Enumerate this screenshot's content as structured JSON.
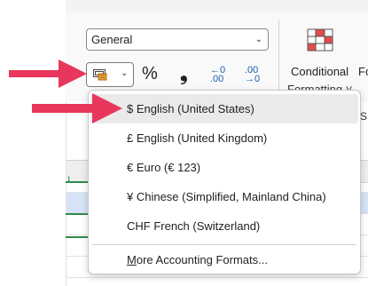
{
  "ribbon": {
    "number_format_value": "General",
    "percent_symbol": "%",
    "comma_symbol": "❟",
    "increase_decimal": {
      "top": "←0",
      "bottom": ".00"
    },
    "decrease_decimal": {
      "top": ".00",
      "bottom": "→0"
    },
    "conditional_formatting_label": "Conditional",
    "conditional_formatting_label_line2": "Formatting ˅",
    "format_label_partial": "Fo",
    "colors": {
      "accent": "#e8365d",
      "green": "#2e8b4a",
      "selection": "#d6e3f6"
    }
  },
  "accounting_menu": {
    "items": [
      {
        "label": "$ English (United States)"
      },
      {
        "label": "£ English (United Kingdom)"
      },
      {
        "label": "€ Euro (€ 123)"
      },
      {
        "label": "¥ Chinese (Simplified, Mainland China)"
      },
      {
        "label": "CHF French (Switzerland)"
      }
    ],
    "more_prefix": "M",
    "more_rest": "ore Accounting Formats..."
  },
  "side_labels": {
    "left_mark": "ı",
    "right_mark": "S"
  }
}
